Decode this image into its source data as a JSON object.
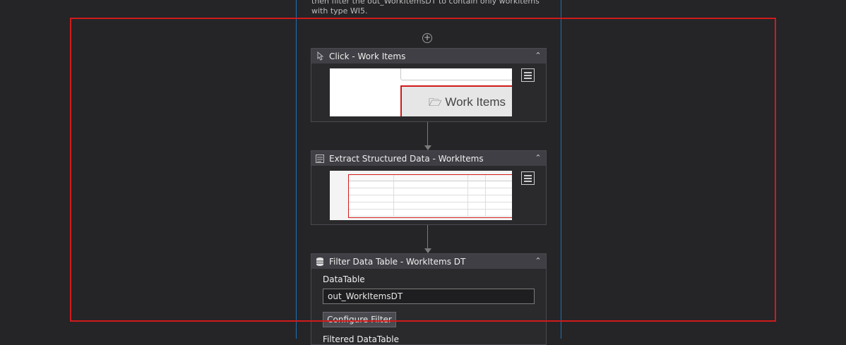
{
  "sequence_note": "then filter the out_WorkItemsDT to contain only workitems with type WI5.",
  "activities": [
    {
      "title": "Click - Work Items",
      "icon": "click-icon",
      "preview_text": "Work Items"
    },
    {
      "title": "Extract Structured Data - WorkItems",
      "icon": "extract-data-icon"
    },
    {
      "title": "Filter Data Table - WorkItems DT",
      "icon": "database-icon",
      "datatable_label": "DataTable",
      "datatable_value": "out_WorkItemsDT",
      "configure_label": "Configure Filter",
      "next_label": "Filtered DataTable"
    }
  ],
  "colors": {
    "background": "#252528",
    "sequence_border": "#1f6fb3",
    "selection_highlight": "#d11a1a",
    "header": "#3f3f45"
  }
}
